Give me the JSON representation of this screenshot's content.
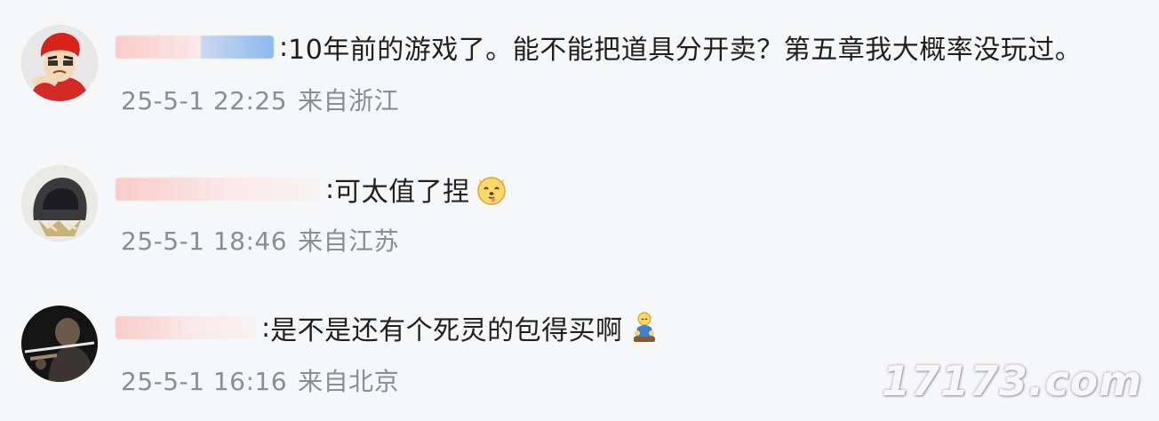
{
  "comments": [
    {
      "username": "████████",
      "separator": ":",
      "text": "10年前的游戏了。能不能把道具分开卖？第五章我大概率没玩过。",
      "time": "25-5-1 22:25",
      "location": "来自浙江",
      "emoji": ""
    },
    {
      "username": "████████████",
      "separator": ":",
      "text": "可太值了捏",
      "time": "25-5-1 18:46",
      "location": "来自江苏",
      "emoji": "dog-face-emoji"
    },
    {
      "username": "████████████",
      "separator": ":",
      "text": "是不是还有个死灵的包得买啊",
      "time": "25-5-1 16:16",
      "location": "来自北京",
      "emoji": "kneeling-person-emoji"
    }
  ],
  "watermark": "17173.com",
  "colors": {
    "background": "#f6f7f9",
    "text": "#1f1f1f",
    "meta": "#8a8d93"
  }
}
